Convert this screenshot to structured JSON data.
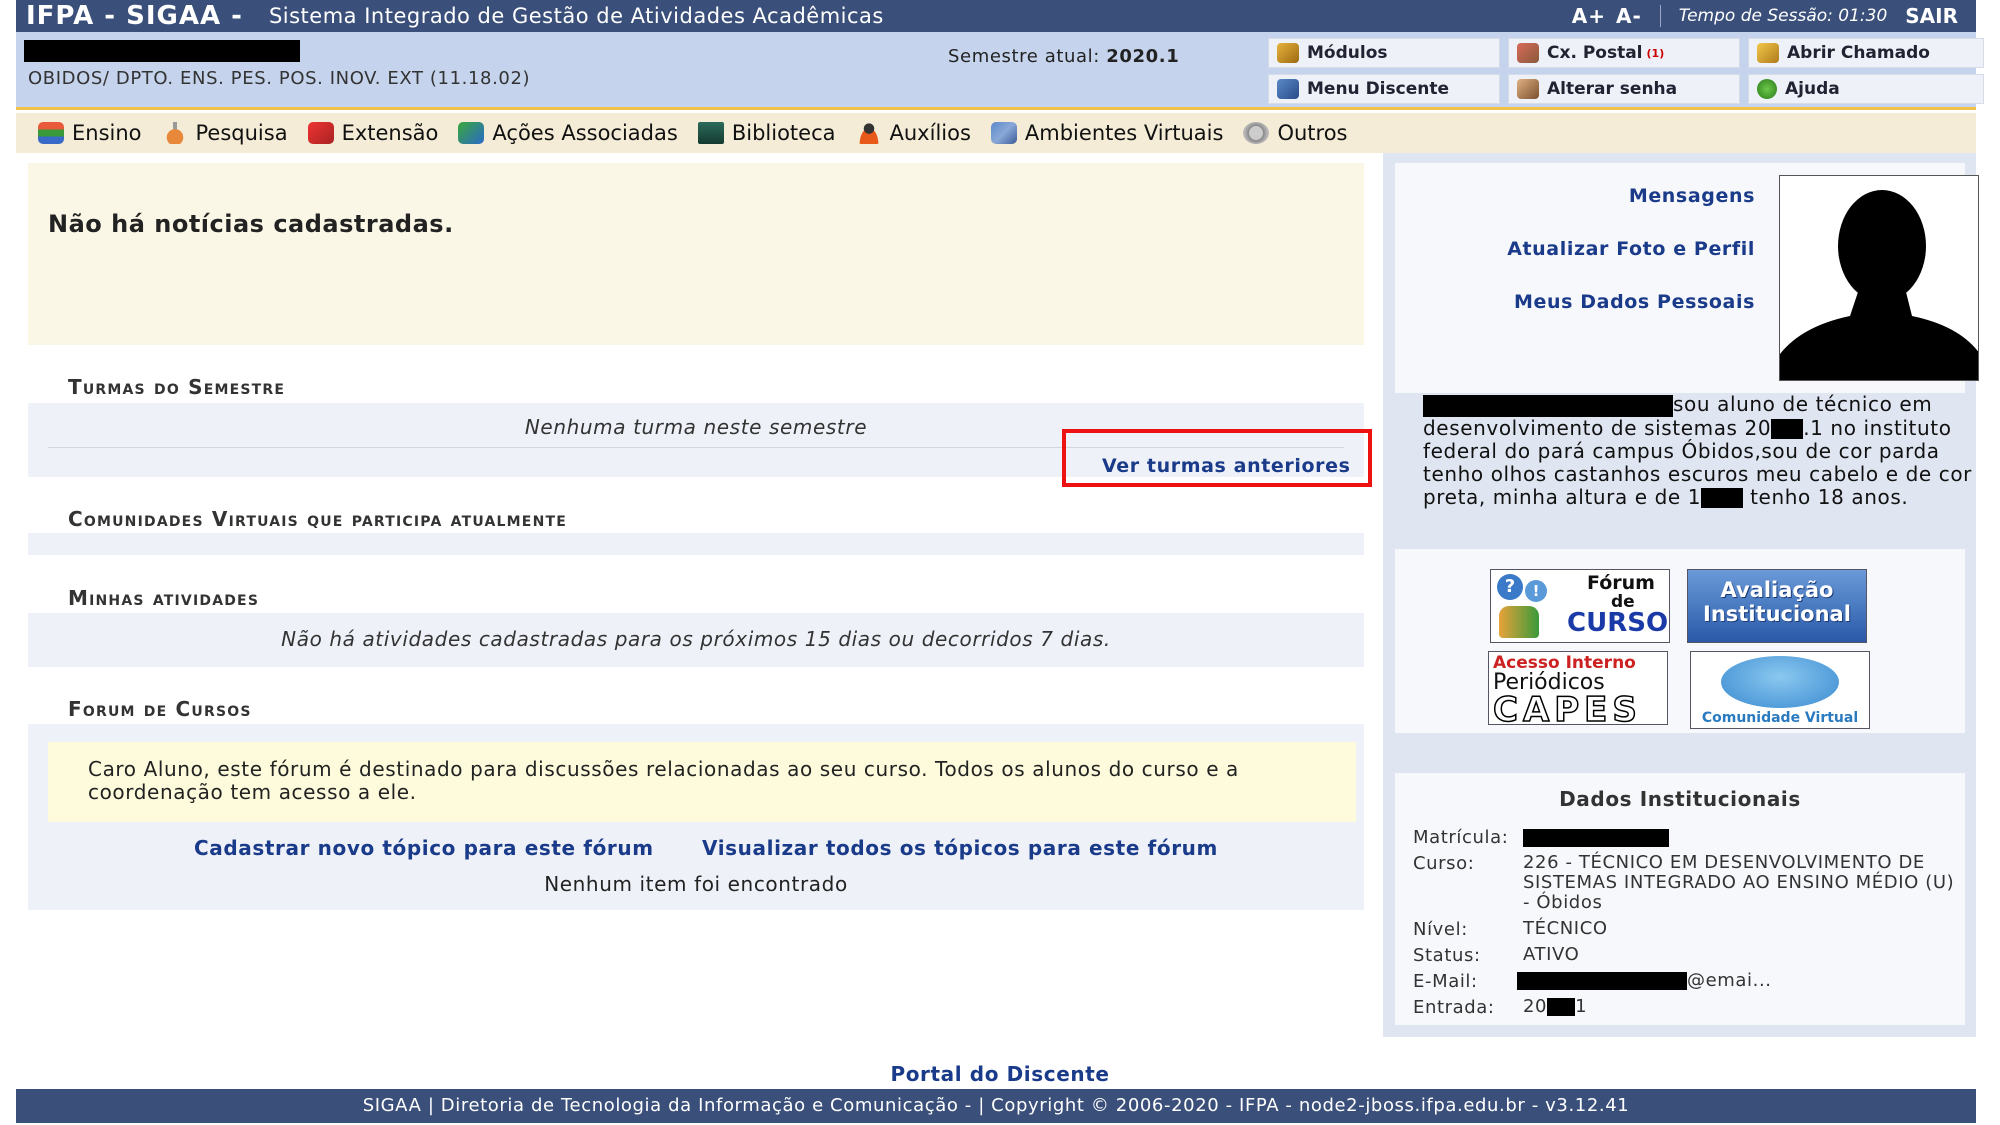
{
  "header": {
    "brand": "IFPA - SIGAA -",
    "system_name": "Sistema Integrado de Gestão de Atividades Acadêmicas",
    "font_increase": "A+",
    "font_decrease": "A-",
    "session": "Tempo de Sessão: 01:30",
    "logout": "SAIR"
  },
  "info": {
    "unit": "OBIDOS/ DPTO. ENS. PES. POS. INOV. EXT (11.18.02)",
    "semester_label": "Semestre atual:",
    "semester_value": "2020.1"
  },
  "quick_links": {
    "modulos": "Módulos",
    "cx_postal": "Cx. Postal",
    "cx_postal_badge": "(1)",
    "abrir_chamado": "Abrir Chamado",
    "menu_discente": "Menu Discente",
    "alterar_senha": "Alterar senha",
    "ajuda": "Ajuda"
  },
  "menu": {
    "ensino": "Ensino",
    "pesquisa": "Pesquisa",
    "extensao": "Extensão",
    "acoes": "Ações Associadas",
    "biblioteca": "Biblioteca",
    "auxilios": "Auxílios",
    "ambientes": "Ambientes Virtuais",
    "outros": "Outros"
  },
  "news": {
    "empty": "Não há notícias cadastradas."
  },
  "turmas": {
    "title": "Turmas do Semestre",
    "empty": "Nenhuma turma neste semestre",
    "link": "Ver turmas anteriores"
  },
  "comunidades": {
    "title": "Comunidades Virtuais que participa atualmente"
  },
  "atividades": {
    "title": "Minhas atividades",
    "empty": "Não há atividades cadastradas para os próximos 15 dias ou decorridos 7 dias."
  },
  "forum": {
    "title": "Forum de Cursos",
    "note": "Caro Aluno, este fórum é destinado para discussões relacionadas ao seu curso. Todos os alunos do curso e a coordenação tem acesso a ele.",
    "new_topic": "Cadastrar novo tópico para este fórum",
    "view_topics": "Visualizar todos os tópicos para este fórum",
    "empty": "Nenhum item foi encontrado"
  },
  "profile": {
    "mensagens": "Mensagens",
    "atualizar": "Atualizar Foto e Perfil",
    "dados_pessoais": "Meus Dados Pessoais",
    "bio_1": "sou aluno de técnico em desenvolvimento de sistemas 20",
    "bio_2": ".1 no instituto federal do pará campus Óbidos,sou de cor parda tenho olhos castanhos escuros meu cabelo e de cor preta, minha altura e de 1",
    "bio_3": "tenho 18 anos."
  },
  "banners": {
    "forum_1": "Fórum",
    "forum_2": "de",
    "forum_3": "CURSO",
    "avaliacao_1": "Avaliação",
    "avaliacao_2": "Institucional",
    "capes_1": "Acesso Interno",
    "capes_2": "Periódicos",
    "capes_3": "CAPES",
    "comunidade": "Comunidade Virtual"
  },
  "dados": {
    "title": "Dados Institucionais",
    "matricula_label": "Matrícula:",
    "curso_label": "Curso:",
    "curso_value": "226 - TÉCNICO EM DESENVOLVIMENTO DE SISTEMAS INTEGRADO AO ENSINO MÉDIO (U) - Óbidos",
    "nivel_label": "Nível:",
    "nivel_value": "TÉCNICO",
    "status_label": "Status:",
    "status_value": "ATIVO",
    "email_label": "E-Mail:",
    "email_suffix": "@emai...",
    "entrada_label": "Entrada:",
    "entrada_prefix": "20",
    "entrada_suffix": "1"
  },
  "footer": {
    "portal": "Portal do Discente",
    "copyright": "SIGAA | Diretoria de Tecnologia da Informação e Comunicação - | Copyright © 2006-2020 - IFPA - node2-jboss.ifpa.edu.br - v3.12.41"
  },
  "colors": {
    "topbar": "#3a4f7a",
    "link": "#1a3a8a",
    "highlight": "#e11111"
  }
}
